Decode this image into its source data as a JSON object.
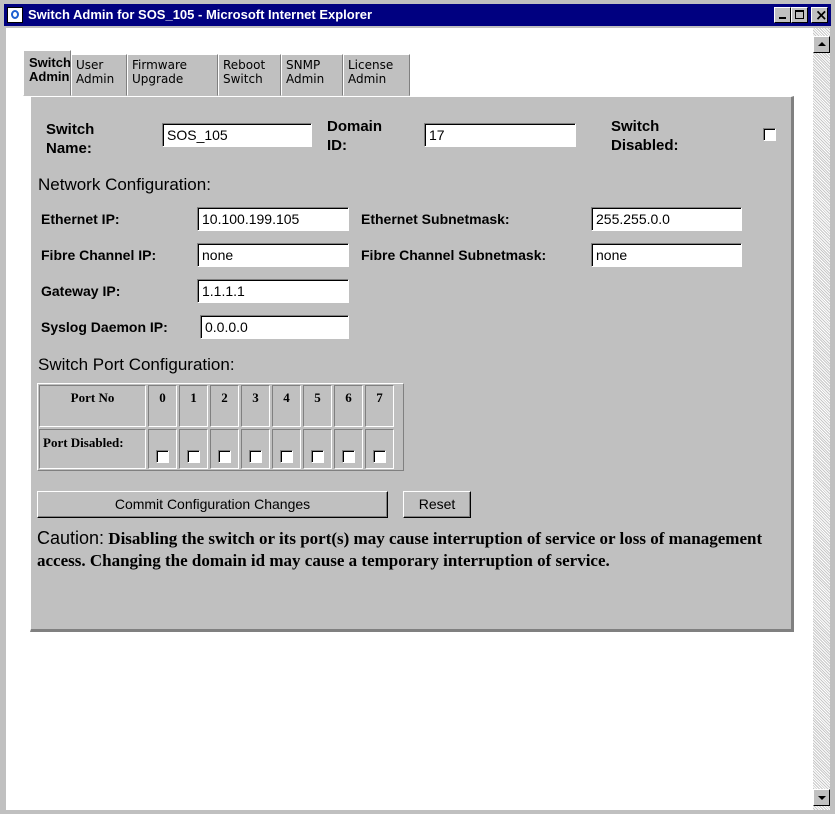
{
  "window": {
    "title": "Switch Admin for SOS_105 - Microsoft Internet Explorer"
  },
  "tabs": [
    {
      "line1": "Switch",
      "line2": "Admin",
      "active": true
    },
    {
      "line1": "User",
      "line2": "Admin",
      "active": false
    },
    {
      "line1": "Firmware",
      "line2": "Upgrade",
      "active": false
    },
    {
      "line1": "Reboot",
      "line2": "Switch",
      "active": false
    },
    {
      "line1": "SNMP",
      "line2": "Admin",
      "active": false
    },
    {
      "line1": "License",
      "line2": "Admin",
      "active": false
    }
  ],
  "switch": {
    "name_label1": "Switch",
    "name_label2": "Name:",
    "name_value": "SOS_105",
    "domain_label1": "Domain",
    "domain_label2": "ID:",
    "domain_value": "17",
    "disabled_label1": "Switch",
    "disabled_label2": "Disabled:",
    "disabled_checked": false
  },
  "network": {
    "heading": "Network Configuration:",
    "ethernet_ip_label": "Ethernet IP:",
    "ethernet_ip": "10.100.199.105",
    "ethernet_mask_label": "Ethernet Subnetmask:",
    "ethernet_mask": "255.255.0.0",
    "fc_ip_label": "Fibre Channel IP:",
    "fc_ip": "none",
    "fc_mask_label": "Fibre Channel Subnetmask:",
    "fc_mask": "none",
    "gateway_label": "Gateway IP:",
    "gateway": "1.1.1.1",
    "syslog_label": "Syslog Daemon IP:",
    "syslog": "0.0.0.0"
  },
  "ports": {
    "heading": "Switch Port Configuration:",
    "port_no_label": "Port No",
    "disabled_label": "Port Disabled:",
    "numbers": [
      "0",
      "1",
      "2",
      "3",
      "4",
      "5",
      "6",
      "7"
    ]
  },
  "actions": {
    "commit_label": "Commit Configuration Changes",
    "reset_label": "Reset"
  },
  "caution": {
    "word": "Caution:",
    "text": "Disabling the switch or its port(s) may cause interruption of service or loss of management access.  Changing the domain id may cause a temporary interruption of service."
  }
}
